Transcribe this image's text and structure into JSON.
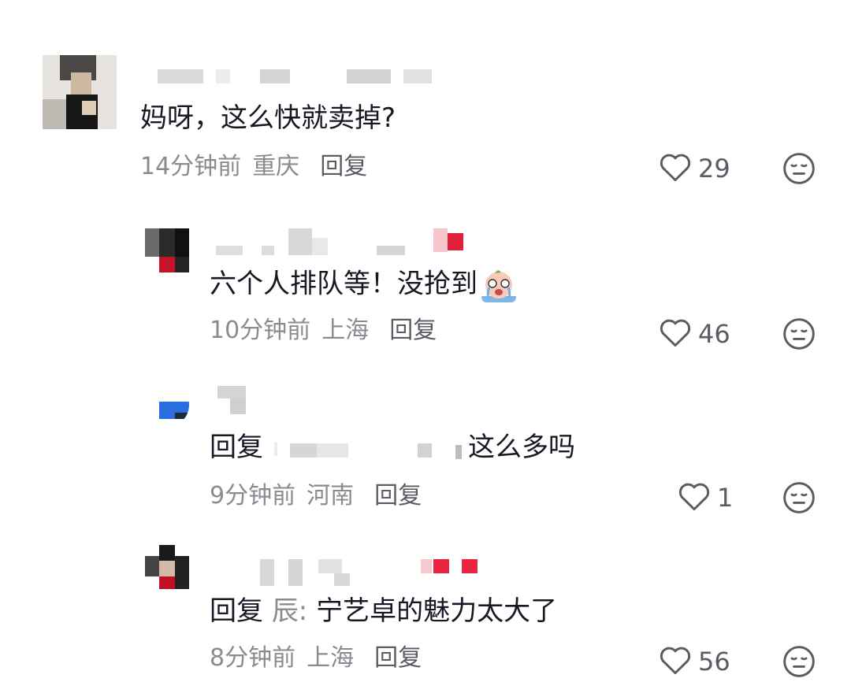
{
  "comments": [
    {
      "text": "妈呀，这么快就卖掉?",
      "time": "14分钟前",
      "location": "重庆",
      "reply_label": "回复",
      "likes": "29"
    },
    {
      "text": "六个人排队等！没抢到",
      "emoji": "crying-face-emoji",
      "time": "10分钟前",
      "location": "上海",
      "reply_label": "回复",
      "likes": "46"
    },
    {
      "text_prefix": "回复",
      "text_suffix": "这么多吗",
      "time": "9分钟前",
      "location": "河南",
      "reply_label": "回复",
      "likes": "1"
    },
    {
      "text_prefix": "回复",
      "mention": "辰:",
      "text": "宁艺卓的魅力太大了",
      "time": "8分钟前",
      "location": "上海",
      "reply_label": "回复",
      "likes": "56"
    }
  ],
  "icons": {
    "like": "heart-outline-icon",
    "dislike": "neutral-face-icon"
  },
  "colors": {
    "text": "#161823",
    "meta": "#8a8b91",
    "icon": "#5a5b63"
  }
}
